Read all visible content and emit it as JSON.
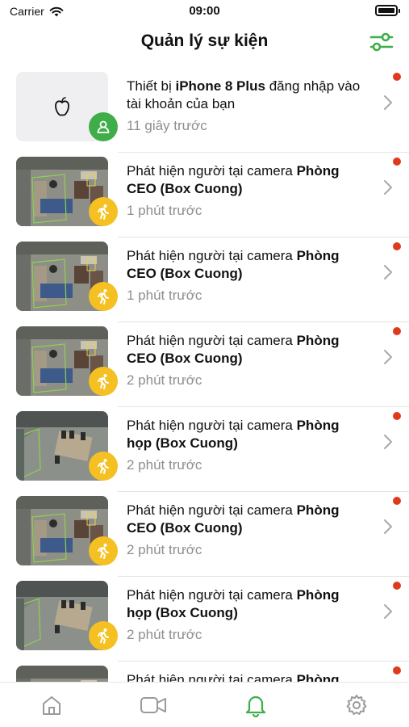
{
  "status_bar": {
    "carrier": "Carrier",
    "time": "09:00"
  },
  "header": {
    "title": "Quản lý sự kiện",
    "filter_icon": "sliders-icon"
  },
  "colors": {
    "accent": "#3fae49",
    "motion_badge": "#f5c022",
    "unread_dot": "#e03a1e",
    "secondary_text": "#8e8e93"
  },
  "events": [
    {
      "type": "login",
      "pre": "Thiết bị ",
      "bold": "iPhone 8 Plus",
      "post": " đăng nhập vào tài khoản của bạn",
      "time": "11 giây trước",
      "thumb": "apple-logo",
      "badge_icon": "person-icon"
    },
    {
      "type": "motion",
      "pre": "Phát hiện người tại camera ",
      "bold": "Phòng CEO (Box Cuong)",
      "post": "",
      "time": "1 phút trước",
      "thumb": "office",
      "badge_icon": "running-person-icon"
    },
    {
      "type": "motion",
      "pre": "Phát hiện người tại camera ",
      "bold": "Phòng CEO (Box Cuong)",
      "post": "",
      "time": "1 phút trước",
      "thumb": "office",
      "badge_icon": "running-person-icon"
    },
    {
      "type": "motion",
      "pre": "Phát hiện người tại camera ",
      "bold": "Phòng CEO (Box Cuong)",
      "post": "",
      "time": "2 phút trước",
      "thumb": "office",
      "badge_icon": "running-person-icon"
    },
    {
      "type": "motion",
      "pre": "Phát hiện người tại camera ",
      "bold": "Phòng họp (Box Cuong)",
      "post": "",
      "time": "2 phút trước",
      "thumb": "meeting",
      "badge_icon": "running-person-icon"
    },
    {
      "type": "motion",
      "pre": "Phát hiện người tại camera ",
      "bold": "Phòng CEO (Box Cuong)",
      "post": "",
      "time": "2 phút trước",
      "thumb": "office",
      "badge_icon": "running-person-icon"
    },
    {
      "type": "motion",
      "pre": "Phát hiện người tại camera ",
      "bold": "Phòng họp (Box Cuong)",
      "post": "",
      "time": "2 phút trước",
      "thumb": "meeting",
      "badge_icon": "running-person-icon"
    },
    {
      "type": "motion",
      "pre": "Phát hiện người tại camera ",
      "bold": "Phòng",
      "post": "",
      "time": "",
      "thumb": "office",
      "badge_icon": "running-person-icon"
    }
  ],
  "tab_bar": {
    "tabs": [
      {
        "name": "home",
        "icon": "home-icon",
        "active": false
      },
      {
        "name": "camera",
        "icon": "video-camera-icon",
        "active": false
      },
      {
        "name": "notifications",
        "icon": "bell-icon",
        "active": true
      },
      {
        "name": "settings",
        "icon": "gear-icon",
        "active": false
      }
    ]
  }
}
